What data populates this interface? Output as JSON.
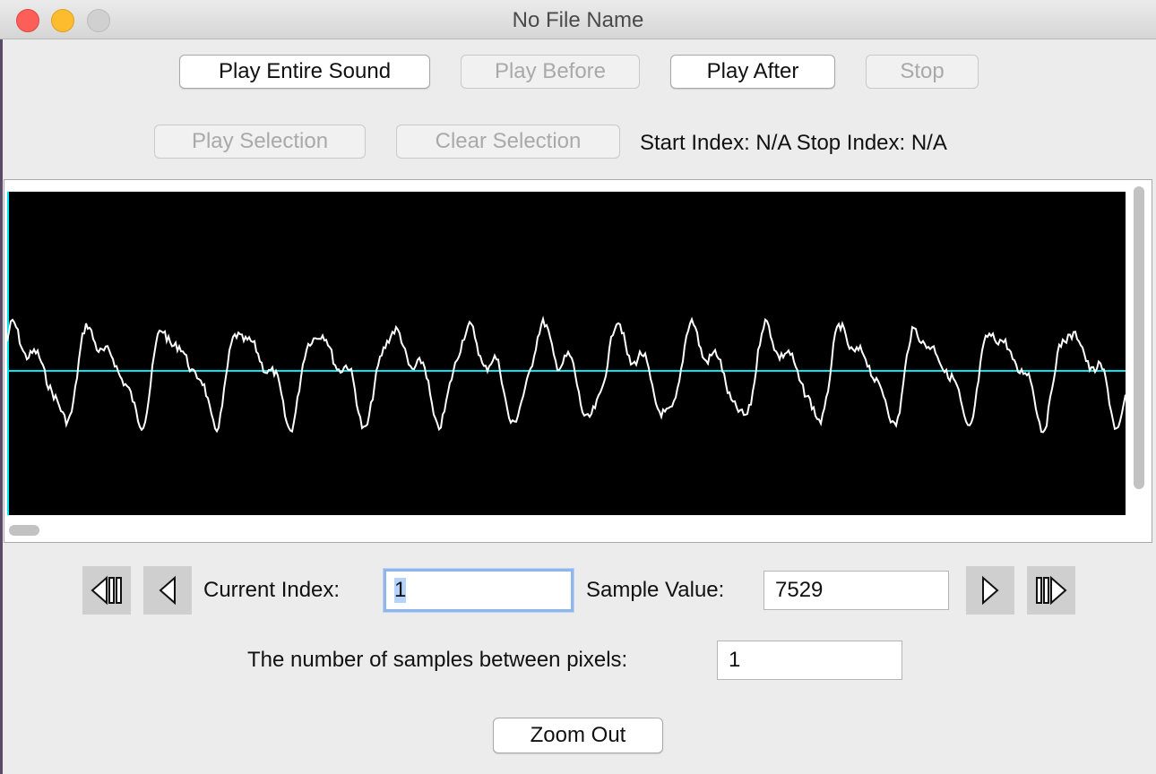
{
  "window": {
    "title": "No File Name",
    "controls": [
      "close",
      "minimize",
      "maximize"
    ]
  },
  "toolbar": {
    "play_entire_sound": "Play Entire Sound",
    "play_before": "Play Before",
    "play_after": "Play After",
    "stop": "Stop",
    "play_selection": "Play Selection",
    "clear_selection": "Clear Selection",
    "start_index_label": "Start Index: N/A",
    "stop_index_label": "Stop Index: N/A"
  },
  "waveform": {
    "background_color": "#000000",
    "wave_color": "#ffffff",
    "axis_color": "#00e5f0",
    "cursor_color": "#00e5f0"
  },
  "navigation": {
    "first_icon": "skip-to-start-icon",
    "prev_icon": "step-back-icon",
    "next_icon": "step-forward-icon",
    "last_icon": "skip-to-end-icon",
    "current_index_label": "Current Index:",
    "current_index_value": "1",
    "sample_value_label": "Sample Value:",
    "sample_value": "7529",
    "samples_between_label": "The number of samples between pixels:",
    "samples_between_value": "1",
    "zoom_out": "Zoom Out"
  }
}
